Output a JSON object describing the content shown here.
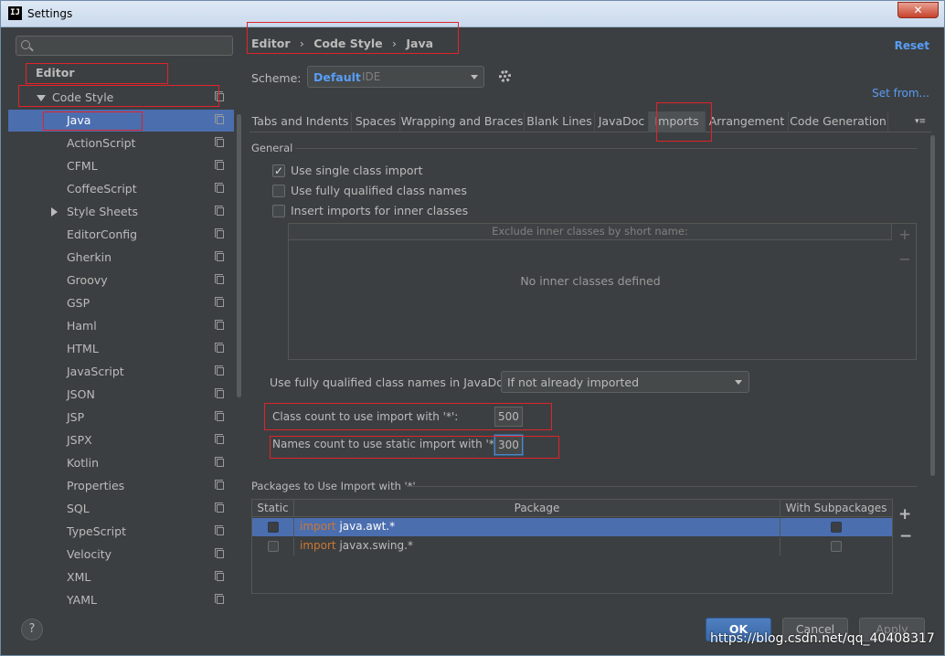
{
  "window": {
    "title": "Settings",
    "app_icon_text": "IJ",
    "close_glyph": "✕"
  },
  "sidebar": {
    "search_placeholder": "",
    "items": [
      {
        "label": "Editor"
      },
      {
        "label": "Code Style"
      },
      {
        "label": "Java"
      },
      {
        "label": "ActionScript"
      },
      {
        "label": "CFML"
      },
      {
        "label": "CoffeeScript"
      },
      {
        "label": "Style Sheets"
      },
      {
        "label": "EditorConfig"
      },
      {
        "label": "Gherkin"
      },
      {
        "label": "Groovy"
      },
      {
        "label": "GSP"
      },
      {
        "label": "Haml"
      },
      {
        "label": "HTML"
      },
      {
        "label": "JavaScript"
      },
      {
        "label": "JSON"
      },
      {
        "label": "JSP"
      },
      {
        "label": "JSPX"
      },
      {
        "label": "Kotlin"
      },
      {
        "label": "Properties"
      },
      {
        "label": "SQL"
      },
      {
        "label": "TypeScript"
      },
      {
        "label": "Velocity"
      },
      {
        "label": "XML"
      },
      {
        "label": "YAML"
      }
    ],
    "help_label": "?"
  },
  "breadcrumb": {
    "items": [
      "Editor",
      "Code Style",
      "Java"
    ],
    "separator": "›"
  },
  "header": {
    "reset_label": "Reset",
    "set_from_label": "Set from..."
  },
  "scheme": {
    "label": "Scheme:",
    "value": "Default",
    "qualifier": "IDE"
  },
  "tabs": [
    {
      "label": "Tabs and Indents"
    },
    {
      "label": "Spaces"
    },
    {
      "label": "Wrapping and Braces"
    },
    {
      "label": "Blank Lines"
    },
    {
      "label": "JavaDoc"
    },
    {
      "label": "Imports"
    },
    {
      "label": "Arrangement"
    },
    {
      "label": "Code Generation"
    }
  ],
  "tabs_more_glyph": "▾≡",
  "general": {
    "title": "General",
    "options": [
      {
        "label": "Use single class import",
        "checked": true
      },
      {
        "label": "Use fully qualified class names",
        "checked": false
      },
      {
        "label": "Insert imports for inner classes",
        "checked": false
      }
    ],
    "exclude_header": "Exclude inner classes by short name:",
    "exclude_empty": "No inner classes defined",
    "javadoc_label": "Use fully qualified class names in JavaDoc:",
    "javadoc_value": "If not already imported",
    "class_count_label": "Class count to use import with '*':",
    "class_count_value": "500",
    "names_count_label": "Names count to use static import with '*':",
    "names_count_value": "300"
  },
  "packages": {
    "title": "Packages to Use Import with '*'",
    "columns": [
      "Static",
      "Package",
      "With Subpackages"
    ],
    "rows": [
      {
        "keyword": "import",
        "package": "java.awt.*",
        "static": false,
        "with_subpackages": true,
        "selected": true
      },
      {
        "keyword": "import",
        "package": "javax.swing.*",
        "static": false,
        "with_subpackages": false,
        "selected": false
      }
    ],
    "add_glyph": "+",
    "remove_glyph": "−"
  },
  "buttons": {
    "ok": "OK",
    "cancel": "Cancel",
    "apply": "Apply"
  },
  "watermark": "https://blog.csdn.net/qq_40408317",
  "colors": {
    "accent": "#4b6eaf",
    "link": "#589df6",
    "highlight_box": "#e0232b",
    "keyword": "#cc7832",
    "background": "#3c3f41"
  }
}
